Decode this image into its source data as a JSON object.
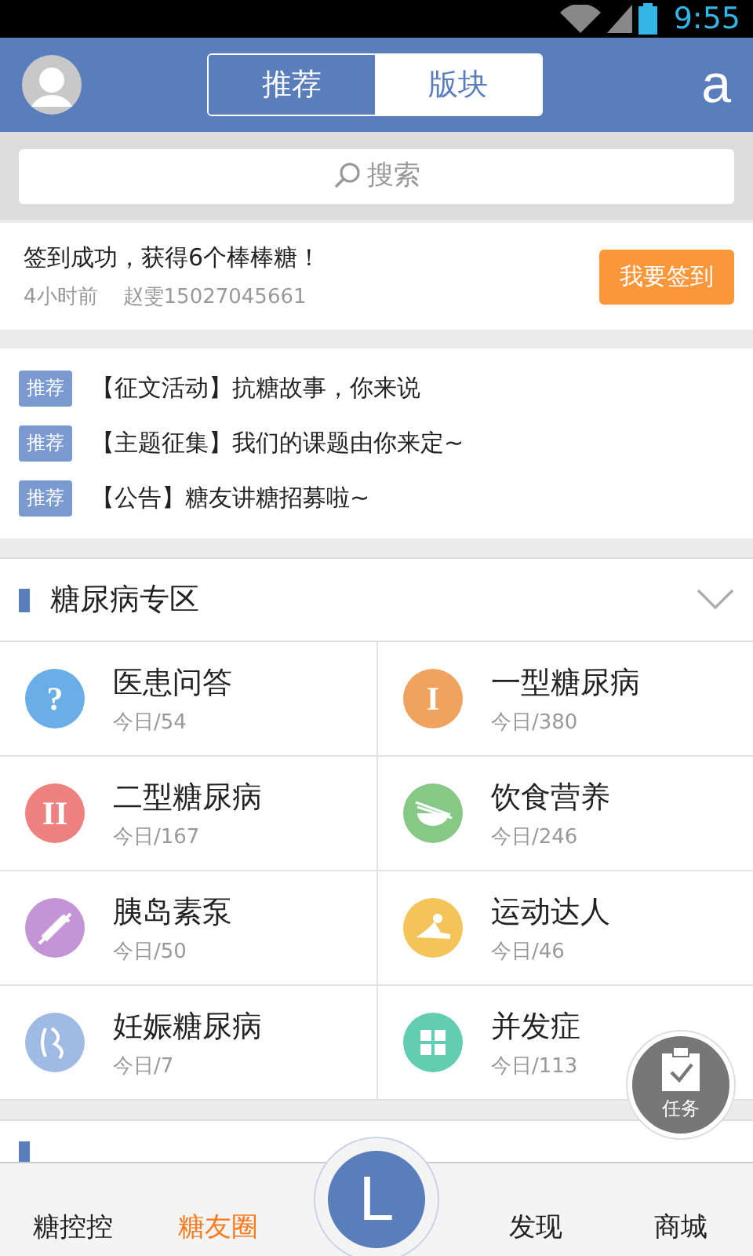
{
  "status_bar": {
    "time": "9:55"
  },
  "header": {
    "tabs": [
      {
        "label": "推荐",
        "selected": true
      },
      {
        "label": "版块",
        "selected": false
      }
    ],
    "right_label": "a"
  },
  "search": {
    "placeholder": "搜索"
  },
  "checkin": {
    "message": "签到成功，获得6个棒棒糖！",
    "time": "4小时前",
    "user": "赵雯15027045661",
    "button": "我要签到"
  },
  "news": [
    {
      "tag": "推荐",
      "title": "【征文活动】抗糖故事，你来说"
    },
    {
      "tag": "推荐",
      "title": "【主题征集】我们的课题由你来定~"
    },
    {
      "tag": "推荐",
      "title": "【公告】糖友讲糖招募啦~"
    }
  ],
  "section": {
    "title": "糖尿病专区"
  },
  "forums": [
    {
      "name": "医患问答",
      "count": "今日/54",
      "kind": "glyph",
      "glyph": "?",
      "color": "#6aaee8"
    },
    {
      "name": "一型糖尿病",
      "count": "今日/380",
      "kind": "glyph",
      "glyph": "I",
      "color": "#f0a35e"
    },
    {
      "name": "二型糖尿病",
      "count": "今日/167",
      "kind": "glyph",
      "glyph": "II",
      "color": "#ef8080"
    },
    {
      "name": "饮食营养",
      "count": "今日/246",
      "kind": "bowl",
      "color": "#86c987"
    },
    {
      "name": "胰岛素泵",
      "count": "今日/50",
      "kind": "syringe",
      "color": "#c395d6"
    },
    {
      "name": "运动达人",
      "count": "今日/46",
      "kind": "swim",
      "color": "#f5c459"
    },
    {
      "name": "妊娠糖尿病",
      "count": "今日/7",
      "kind": "pregnant",
      "color": "#9fbbe4"
    },
    {
      "name": "并发症",
      "count": "今日/113",
      "kind": "grid",
      "color": "#62cdb0"
    }
  ],
  "task_button": {
    "label": "任务"
  },
  "bottom_nav": {
    "items": [
      {
        "label": "糖控控",
        "selected": false
      },
      {
        "label": "糖友圈",
        "selected": true
      },
      {
        "label": "发现",
        "selected": false
      },
      {
        "label": "商城",
        "selected": false
      }
    ],
    "center_label": "L"
  }
}
